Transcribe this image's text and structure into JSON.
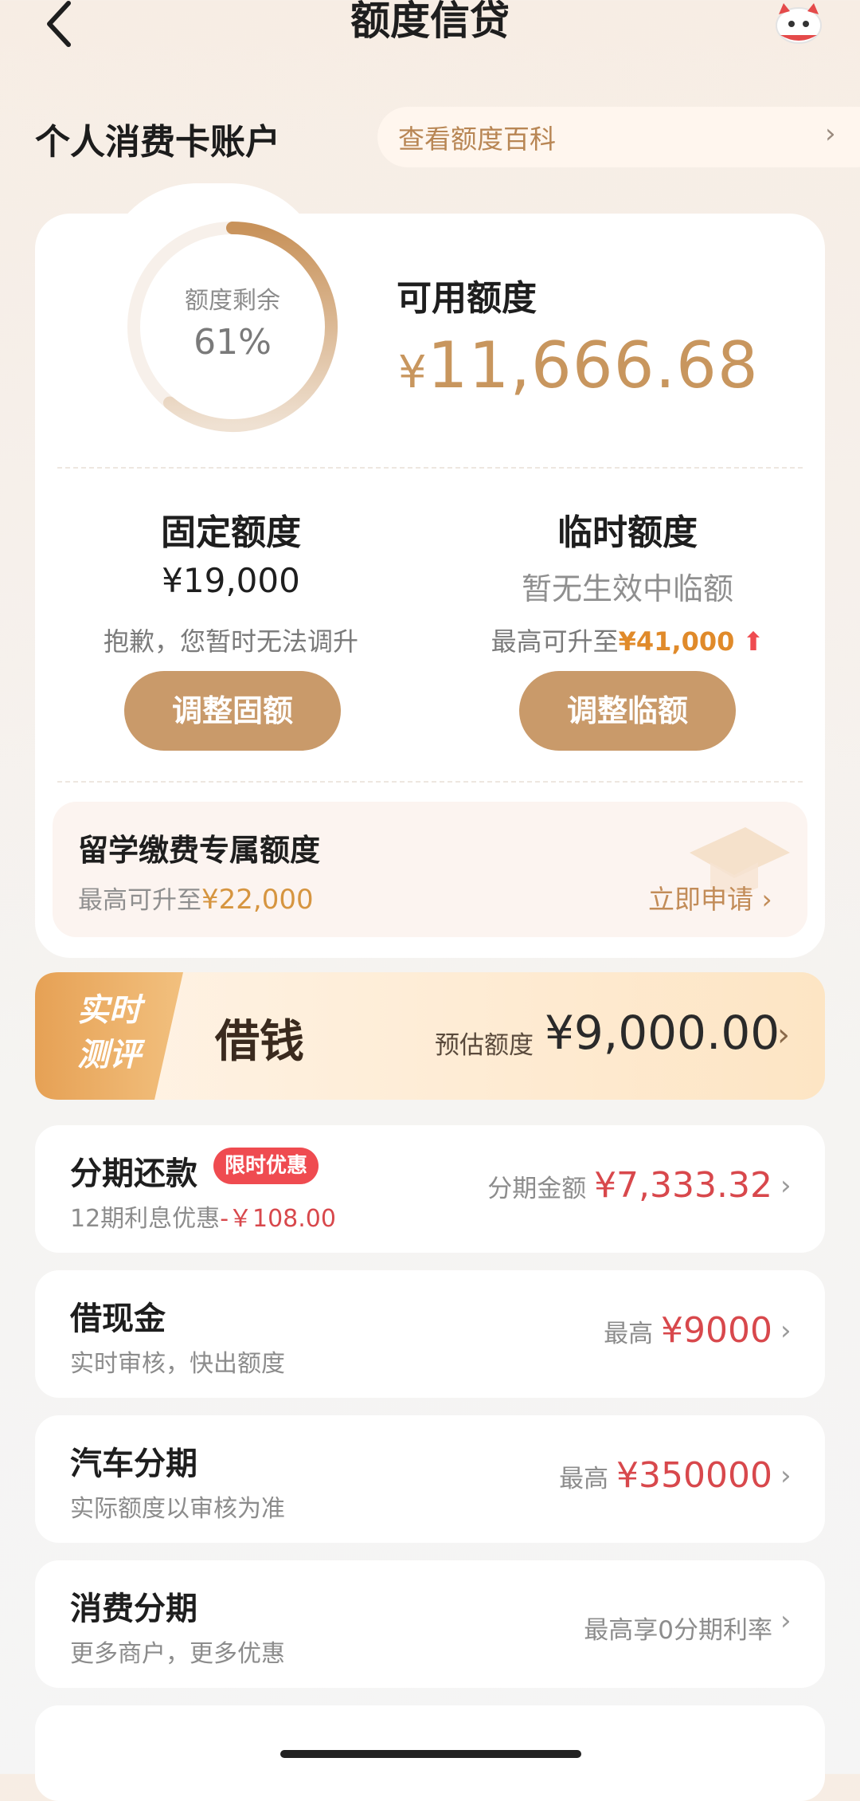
{
  "header": {
    "title": "额度信贷",
    "back_icon": "back-arrow-icon",
    "mascot_icon": "mascot-icon"
  },
  "account": {
    "title": "个人消费卡账户",
    "wiki_text": "查看额度百科"
  },
  "quota": {
    "remaining_label": "额度剩余",
    "remaining_percent": "61%",
    "remaining_fraction": 0.61,
    "available_label": "可用额度",
    "available_currency": "¥",
    "available_amount": "11,666.68"
  },
  "fixed": {
    "title": "固定额度",
    "amount": "¥19,000",
    "note": "抱歉，您暂时无法调升",
    "button": "调整固额"
  },
  "temp": {
    "title": "临时额度",
    "status": "暂无生效中临额",
    "note_prefix": "最高可升至",
    "note_amount": "¥41,000",
    "button": "调整临额"
  },
  "study": {
    "title": "留学缴费专属额度",
    "note_prefix": "最高可升至",
    "note_amount": "¥22,000",
    "cta": "立即申请 ›"
  },
  "borrow": {
    "tag_line1": "实时",
    "tag_line2": "测评",
    "title": "借钱",
    "est_label": "预估额度",
    "amount": "¥9,000.00"
  },
  "items": [
    {
      "title": "分期还款",
      "badge": "限时优惠",
      "sub_prefix": "12期利息优惠",
      "sub_red": "-￥108.00",
      "right_label": "分期金额 ",
      "right_value": "¥7,333.32"
    },
    {
      "title": "借现金",
      "sub_prefix": "实时审核，快出额度",
      "right_label": "最高 ",
      "right_value": "¥9000"
    },
    {
      "title": "汽车分期",
      "sub_prefix": "实际额度以审核为准",
      "right_label": "最高 ",
      "right_value": "¥350000"
    },
    {
      "title": "消费分期",
      "sub_prefix": "更多商户，更多优惠",
      "right_label": "最高享0分期利率",
      "right_value": ""
    }
  ],
  "colors": {
    "accent": "#c99a6a",
    "red": "#d8484c",
    "orange": "#e08a2a"
  }
}
